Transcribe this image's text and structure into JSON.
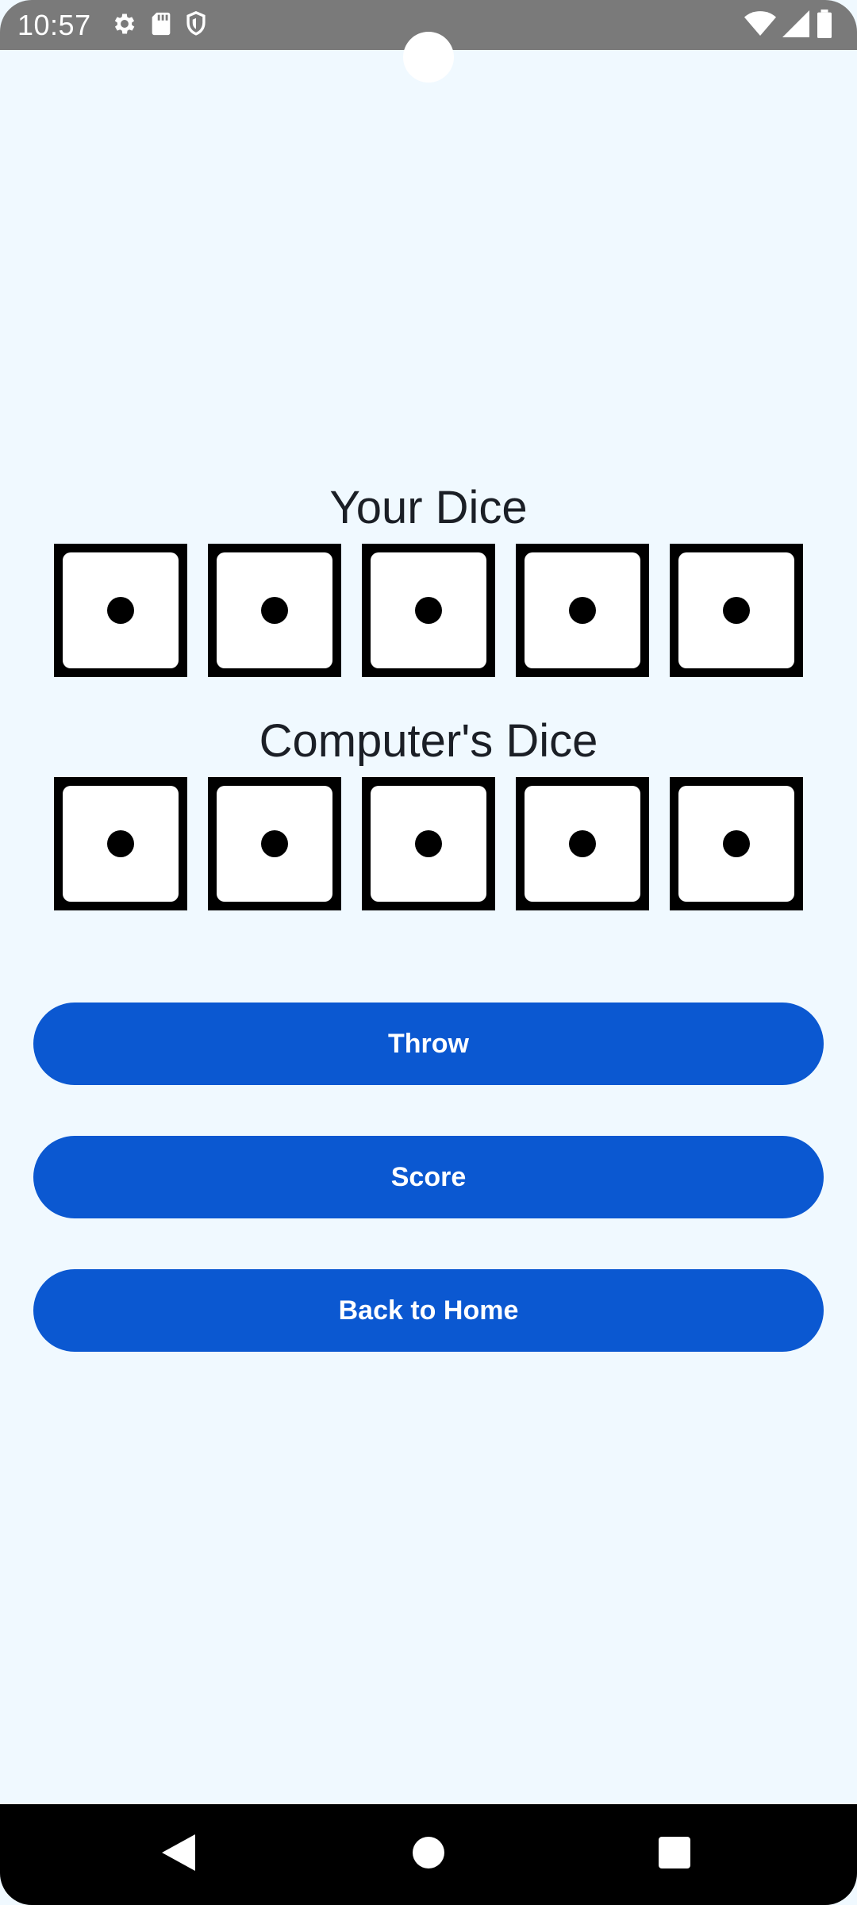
{
  "status_bar": {
    "time": "10:57",
    "left_icons": [
      "settings-icon",
      "sd-card-icon",
      "shield-icon"
    ],
    "right_icons": [
      "wifi-icon",
      "cell-signal-icon",
      "battery-icon"
    ],
    "background_color": "#7a7a7a"
  },
  "game": {
    "your_dice_title": "Your Dice",
    "computer_dice_title": "Computer's Dice",
    "your_dice": [
      1,
      1,
      1,
      1,
      1
    ],
    "computer_dice": [
      1,
      1,
      1,
      1,
      1
    ]
  },
  "buttons": {
    "throw_label": "Throw",
    "score_label": "Score",
    "back_label": "Back to Home"
  },
  "nav_bar": {
    "buttons": [
      "back-icon",
      "home-icon",
      "recents-icon"
    ]
  },
  "colors": {
    "background": "#f0f9ff",
    "button": "#0b58d1",
    "button_text": "#ffffff",
    "title_text": "#1b1f26"
  }
}
